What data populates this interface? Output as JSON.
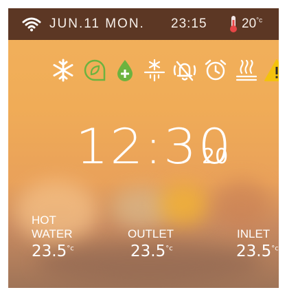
{
  "status_bar": {
    "date": "JUN.11 MON.",
    "time": "23:15",
    "temperature": "20",
    "temperature_unit": "°c"
  },
  "mode_icons": [
    "snowflake-icon",
    "eco-leaf-icon",
    "water-drop-plus-icon",
    "defrost-icon",
    "mute-bell-icon",
    "alarm-clock-icon",
    "floor-heating-icon",
    "warning-icon"
  ],
  "main_clock": {
    "time": "12:30",
    "seconds": "20"
  },
  "readings": [
    {
      "label_line1": "HOT",
      "label_line2": "WATER",
      "value": "23.5",
      "unit": "°c"
    },
    {
      "label_line1": "",
      "label_line2": "OUTLET",
      "value": "23.5",
      "unit": "°c"
    },
    {
      "label_line1": "",
      "label_line2": "INLET",
      "value": "23.5",
      "unit": "°c"
    }
  ],
  "colors": {
    "topbar": "#5c3724",
    "background": "#f0ac57",
    "icon_white": "#ffffff",
    "icon_green": "#6cb33f",
    "icon_warning": "#f4c20d"
  }
}
